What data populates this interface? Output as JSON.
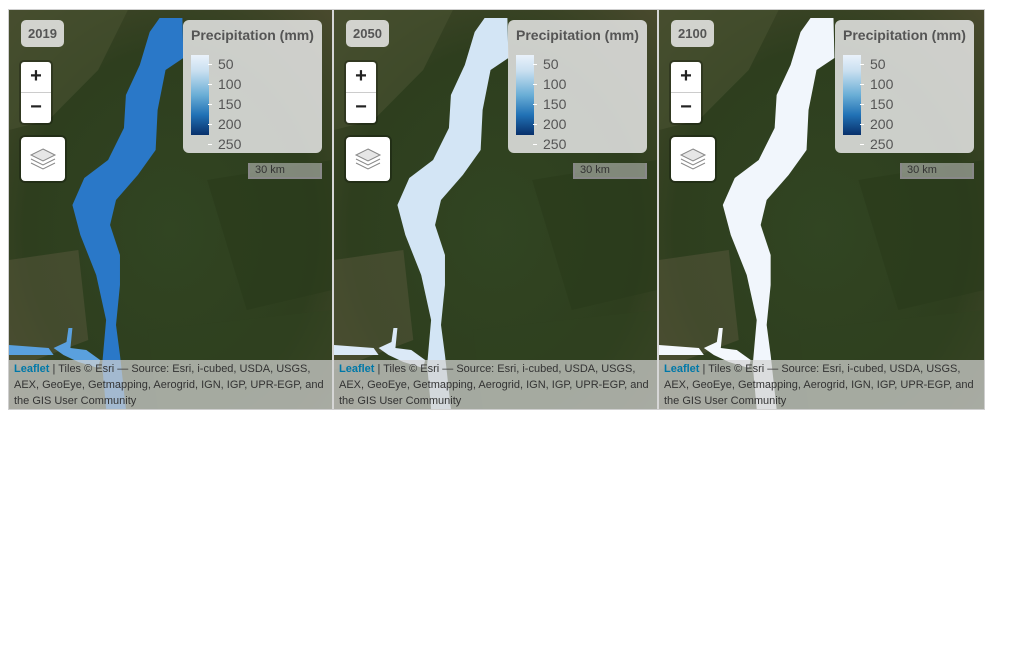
{
  "legend": {
    "title": "Precipitation (mm)",
    "ticks": [
      "50",
      "100",
      "150",
      "200",
      "250"
    ]
  },
  "panels": [
    {
      "year": "2019",
      "river_color": "#2a78c8",
      "river_color_light": "#5aa0de"
    },
    {
      "year": "2050",
      "river_color": "#d3e5f5",
      "river_color_light": "#dbe9f7"
    },
    {
      "year": "2100",
      "river_color": "#f1f6fc",
      "river_color_light": "#f4f8fd"
    }
  ],
  "controls": {
    "zoom_in": "+",
    "zoom_out": "−",
    "layers_icon": "layers-icon"
  },
  "scale_label": "30 km",
  "attribution": {
    "link": "Leaflet",
    "text": " | Tiles © Esri — Source: Esri, i-cubed, USDA, USGS, AEX, GeoEye, Getmapping, Aerogrid, IGN, IGP, UPR-EGP, and the GIS User Community"
  },
  "colors": {
    "terrain_dark": "#2b3a1c",
    "terrain_mid": "#3f4f26",
    "terrain_light": "#5c5f38"
  }
}
